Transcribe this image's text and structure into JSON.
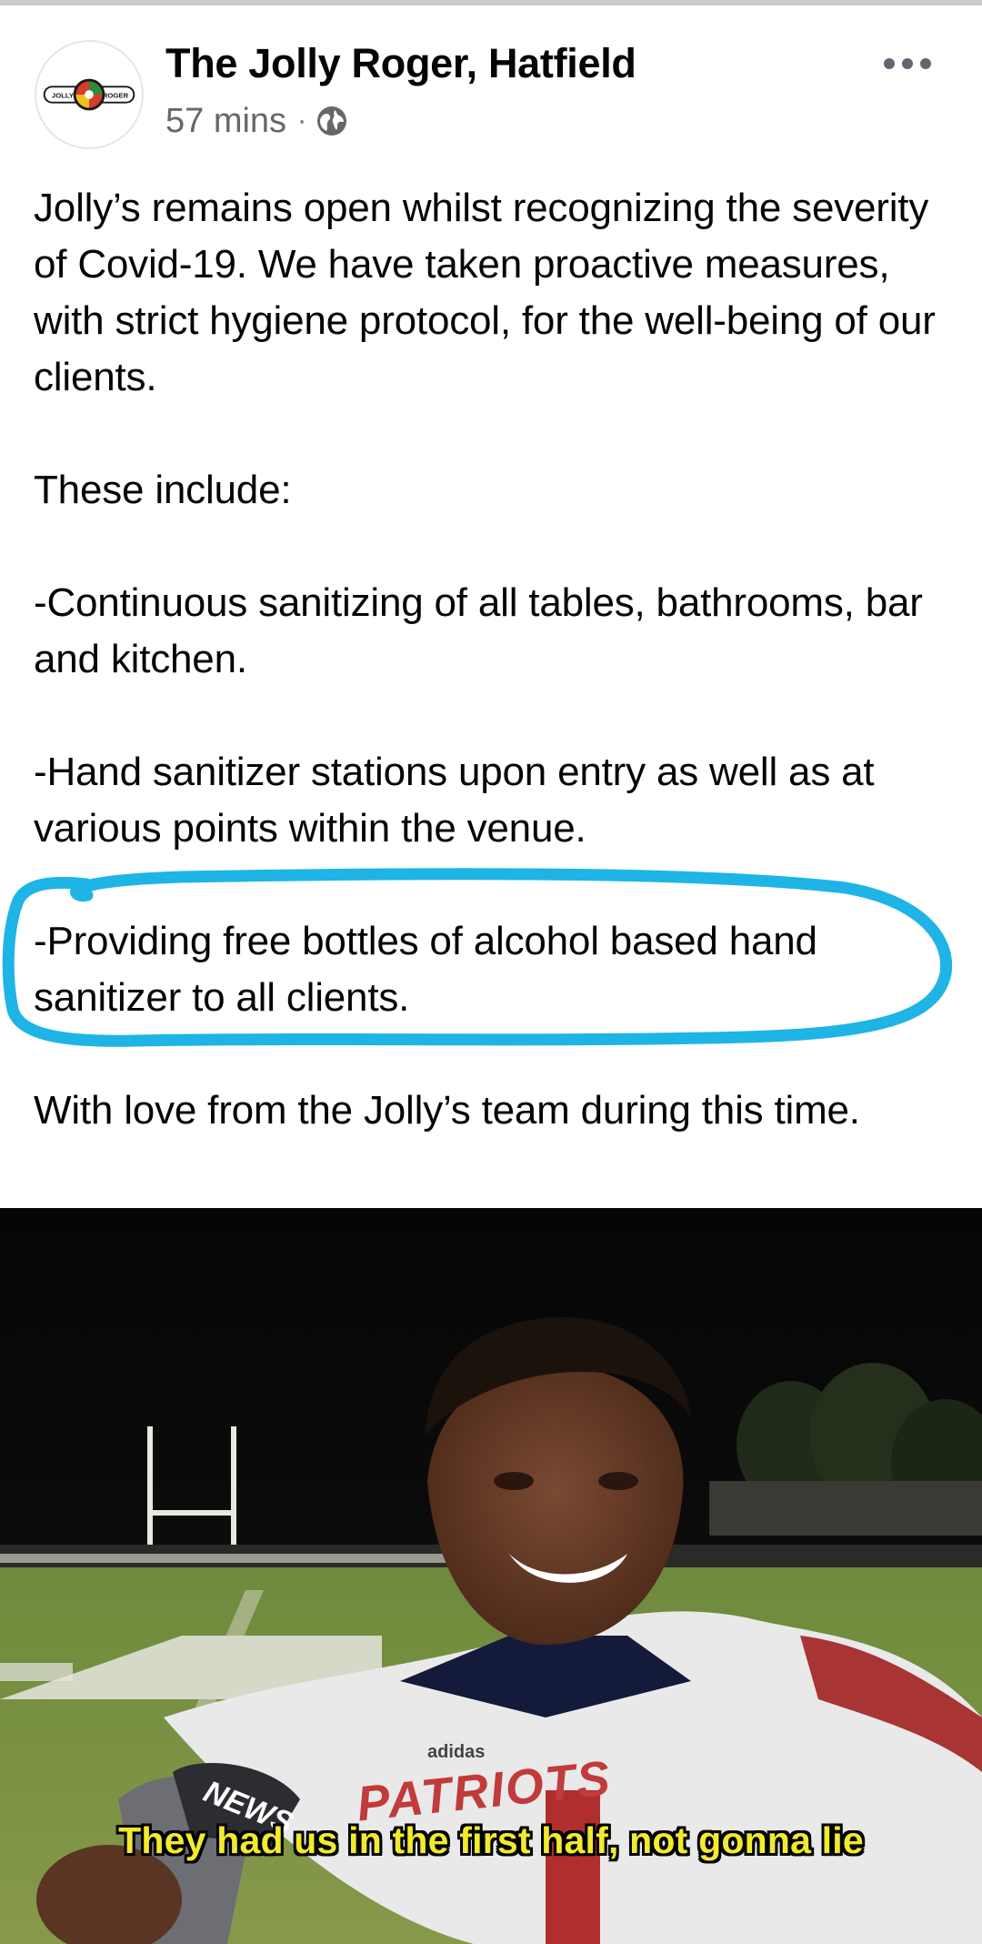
{
  "post": {
    "page_name": "The Jolly Roger, Hatfield",
    "timestamp": "57 mins",
    "separator": "·",
    "privacy_icon": "globe-icon",
    "more_icon": "more-horizontal-icon",
    "avatar_logo": {
      "left_text": "JOLLY",
      "right_text": "ROGER"
    }
  },
  "body": {
    "paragraph_1": "Jolly’s remains open whilst recognizing the severity of Covid-19. We have taken proactive measures, with strict hygiene protocol, for the well-being of our clients.",
    "paragraph_2": "These include:",
    "paragraph_3": "-Continuous sanitizing of all tables, bathrooms, bar and kitchen.",
    "paragraph_4": "-Hand sanitizer stations upon entry as well as at various points within the venue.",
    "paragraph_5": "-Providing free bottles of alcohol based hand sanitizer to all clients.",
    "paragraph_6": "With love from the Jolly’s team during this time."
  },
  "annotation": {
    "highlight_color": "#1eb4e6"
  },
  "meme": {
    "caption": "They had us in the first half, not gonna lie",
    "jersey_text": "PATRIOTS",
    "brand_text": "adidas",
    "mic_flag_text": "NEWS",
    "caption_color": "#f2ea2c"
  }
}
